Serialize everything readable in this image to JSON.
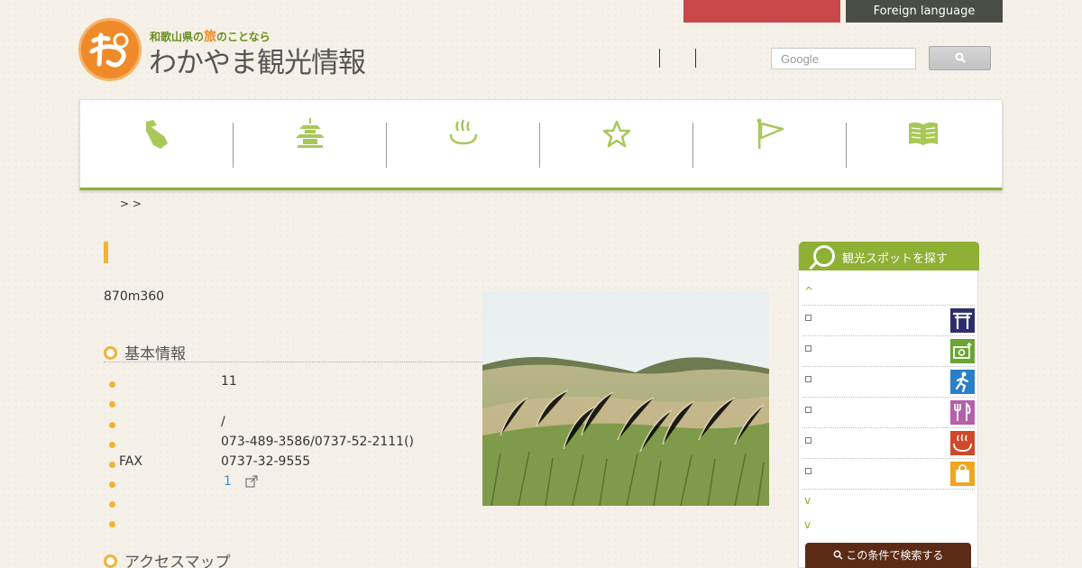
{
  "top_bar": {
    "foreign_language_label": "Foreign language"
  },
  "logo": {
    "tagline_pre": "和歌山県の",
    "tagline_hl": "旅",
    "tagline_post": "のことなら",
    "title": "わかやま観光情報"
  },
  "search": {
    "placeholder": "Google"
  },
  "nav": {
    "items": [
      "map-icon",
      "temple-icon",
      "onsen-icon",
      "star-icon",
      "flag-icon",
      "book-icon"
    ]
  },
  "breadcrumb": {
    "text": "> >"
  },
  "intro_text": "870m360",
  "basic_info": {
    "heading": "基本情報",
    "rows": [
      {
        "label": "",
        "value": "11"
      },
      {
        "label": "",
        "value": ""
      },
      {
        "label": "",
        "value": "/"
      },
      {
        "label": "",
        "value": "073-489-3586/0737-52-2111()"
      },
      {
        "label": "FAX",
        "value": "0737-32-9555"
      },
      {
        "label": "",
        "value": "1"
      },
      {
        "label": "",
        "value": ""
      },
      {
        "label": "",
        "value": ""
      }
    ]
  },
  "access_heading": "アクセスマップ",
  "sidebar": {
    "heading": "観光スポットを探す",
    "up_arrow": "^",
    "down_arrow": "v",
    "categories": [
      "shrine-icon",
      "camera-icon",
      "activity-icon",
      "dining-icon",
      "onsen-icon",
      "shopping-icon"
    ],
    "category_colors": [
      "#2e2d6b",
      "#6aa532",
      "#2a7fc6",
      "#b560a8",
      "#d0482a",
      "#f0a61e"
    ],
    "search_button": "この条件で検索する"
  }
}
